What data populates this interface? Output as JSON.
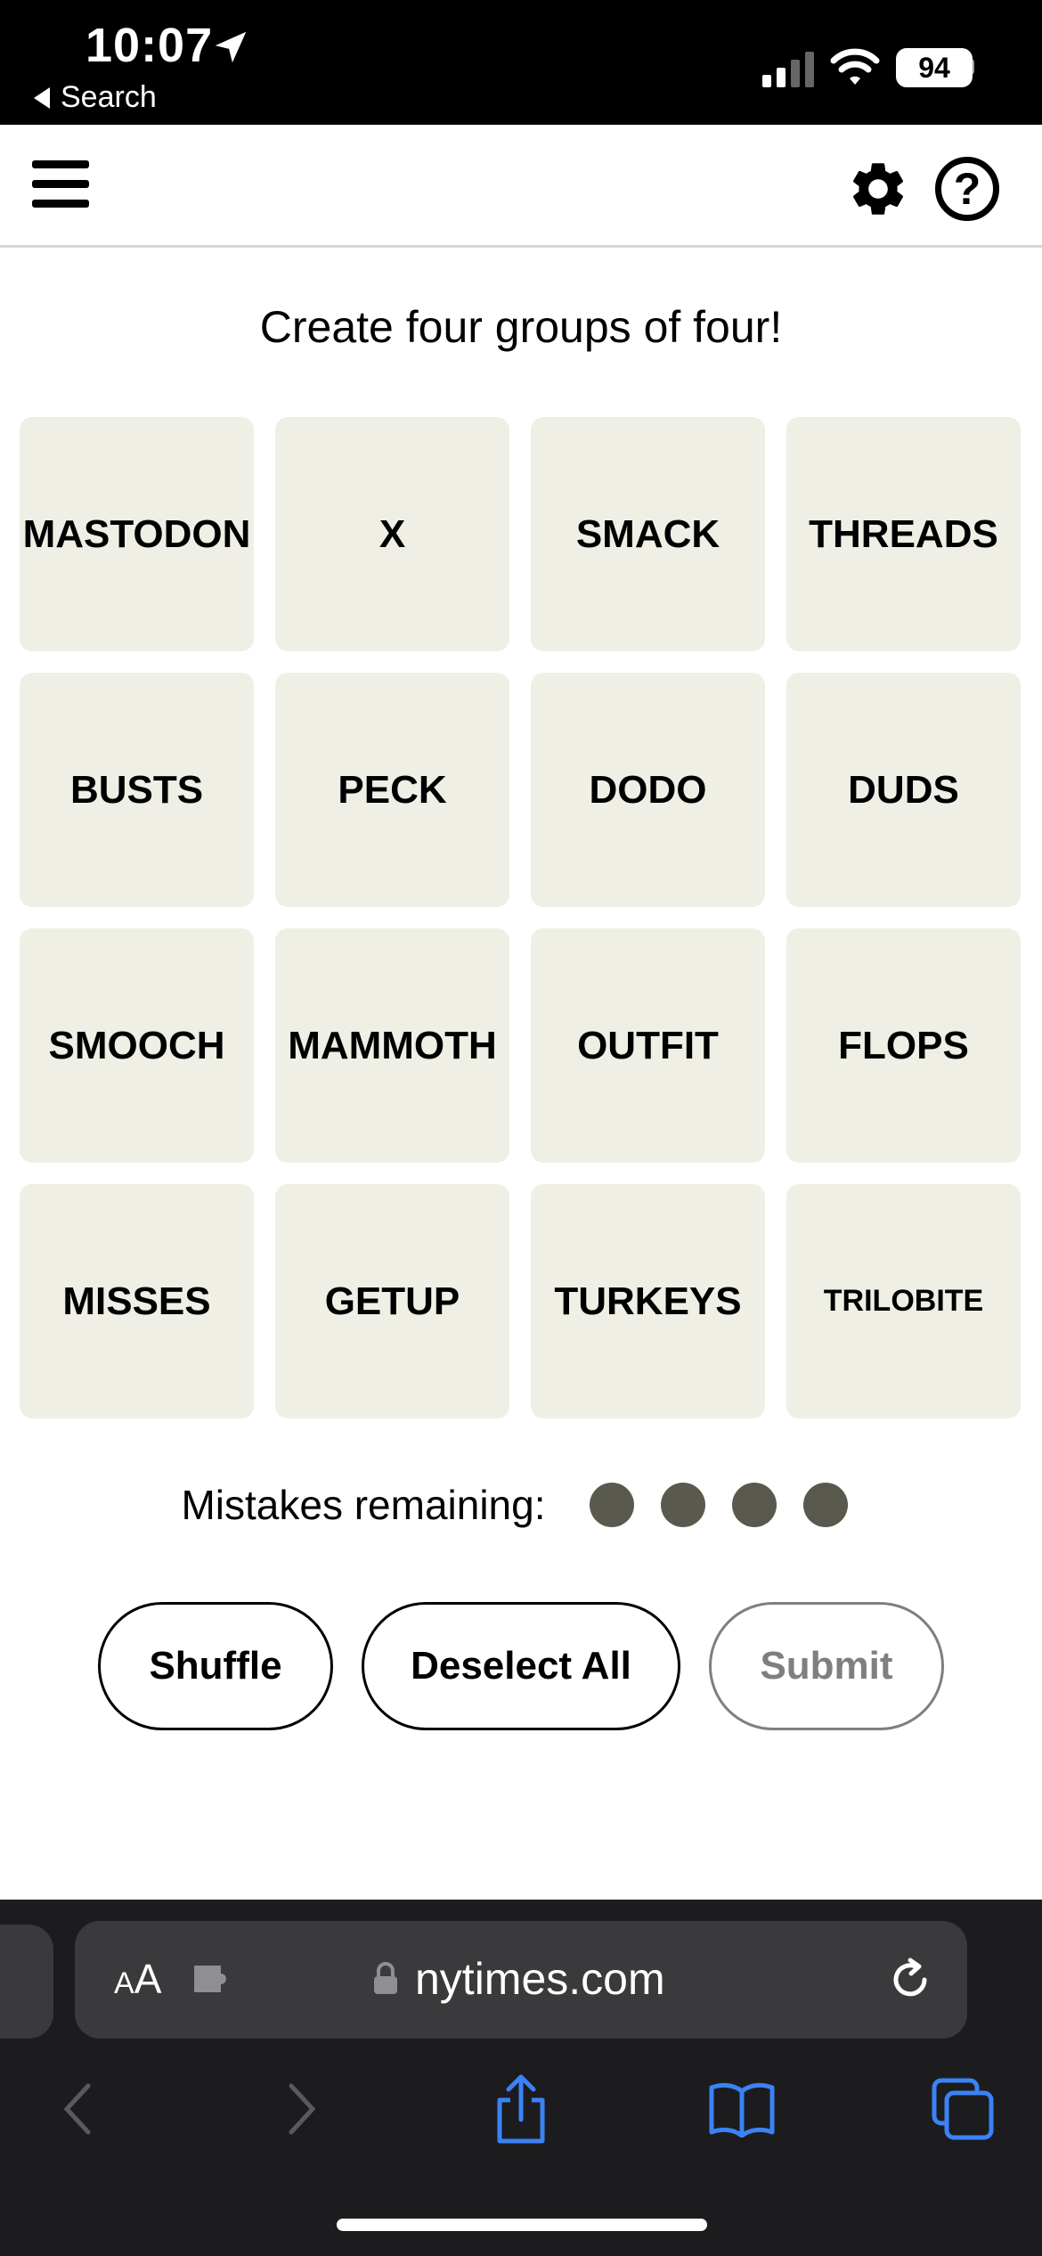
{
  "status_bar": {
    "time": "10:07",
    "back_label": "Search",
    "battery": "94"
  },
  "header": {
    "menu_icon": "hamburger-menu-icon",
    "settings_icon": "gear-icon",
    "help_icon": "question-circle-icon",
    "help_glyph": "?"
  },
  "game": {
    "instructions": "Create four groups of four!",
    "tiles": [
      "MASTODON",
      "X",
      "SMACK",
      "THREADS",
      "BUSTS",
      "PECK",
      "DODO",
      "DUDS",
      "SMOOCH",
      "MAMMOTH",
      "OUTFIT",
      "FLOPS",
      "MISSES",
      "GETUP",
      "TURKEYS",
      "TRILOBITE"
    ],
    "mistakes_label": "Mistakes remaining:",
    "mistakes_remaining": 4,
    "dot_color": "#5a594e",
    "buttons": {
      "shuffle": "Shuffle",
      "deselect": "Deselect All",
      "submit": "Submit"
    }
  },
  "browser": {
    "text_size_label_small": "A",
    "text_size_label_large": "A",
    "url": "nytimes.com",
    "accent_color": "#3b82f6"
  }
}
